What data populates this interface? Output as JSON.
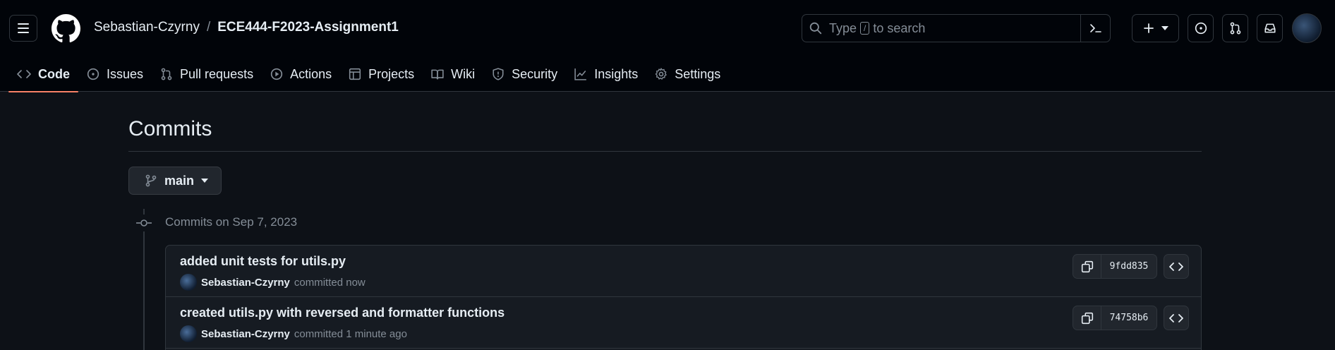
{
  "header": {
    "owner": "Sebastian-Czyrny",
    "separator": "/",
    "repo": "ECE444-F2023-Assignment1",
    "search": {
      "prefix": "Type",
      "key": "/",
      "suffix": "to search"
    }
  },
  "nav": {
    "tabs": [
      {
        "label": "Code",
        "icon": "code-icon",
        "active": true
      },
      {
        "label": "Issues",
        "icon": "issue-opened-icon"
      },
      {
        "label": "Pull requests",
        "icon": "git-pull-request-icon"
      },
      {
        "label": "Actions",
        "icon": "play-icon"
      },
      {
        "label": "Projects",
        "icon": "table-icon"
      },
      {
        "label": "Wiki",
        "icon": "book-icon"
      },
      {
        "label": "Security",
        "icon": "shield-icon"
      },
      {
        "label": "Insights",
        "icon": "graph-icon"
      },
      {
        "label": "Settings",
        "icon": "gear-icon"
      }
    ]
  },
  "page": {
    "title": "Commits",
    "branch": "main",
    "group_title": "Commits on Sep 7, 2023"
  },
  "commits": [
    {
      "message": "added unit tests for utils.py",
      "author": "Sebastian-Czyrny",
      "time": "committed now",
      "sha": "9fdd835"
    },
    {
      "message": "created utils.py with reversed and formatter functions",
      "author": "Sebastian-Czyrny",
      "time": "committed 1 minute ago",
      "sha": "74758b6"
    }
  ],
  "colors": {
    "background": "#0d1117",
    "header": "#010409",
    "border": "#30363d",
    "muted": "#848d97",
    "active_underline": "#f78166"
  }
}
